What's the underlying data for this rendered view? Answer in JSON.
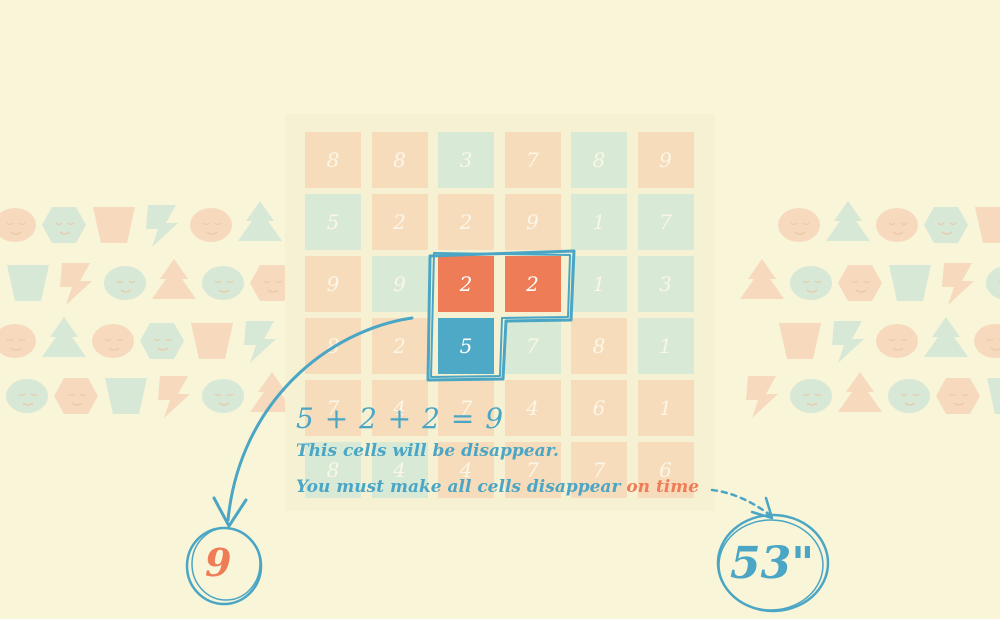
{
  "colors": {
    "background": "#f8f5d8",
    "peach": "#f7dcbc",
    "mint": "#d8e9d6",
    "accent_orange": "#ee7d57",
    "accent_blue": "#4ea9c6"
  },
  "grid": {
    "rows": [
      [
        {
          "v": "8",
          "c": "peach"
        },
        {
          "v": "8",
          "c": "peach"
        },
        {
          "v": "3",
          "c": "mint"
        },
        {
          "v": "7",
          "c": "peach"
        },
        {
          "v": "8",
          "c": "mint"
        },
        {
          "v": "9",
          "c": "peach"
        }
      ],
      [
        {
          "v": "5",
          "c": "mint"
        },
        {
          "v": "2",
          "c": "peach"
        },
        {
          "v": "2",
          "c": "peach"
        },
        {
          "v": "9",
          "c": "peach"
        },
        {
          "v": "1",
          "c": "mint"
        },
        {
          "v": "7",
          "c": "mint"
        }
      ],
      [
        {
          "v": "9",
          "c": "peach"
        },
        {
          "v": "9",
          "c": "mint"
        },
        {
          "v": "2",
          "c": "orange"
        },
        {
          "v": "2",
          "c": "orange"
        },
        {
          "v": "1",
          "c": "mint"
        },
        {
          "v": "3",
          "c": "mint"
        }
      ],
      [
        {
          "v": "8",
          "c": "peach"
        },
        {
          "v": "2",
          "c": "peach"
        },
        {
          "v": "5",
          "c": "blue"
        },
        {
          "v": "7",
          "c": "mint"
        },
        {
          "v": "8",
          "c": "peach"
        },
        {
          "v": "1",
          "c": "mint"
        }
      ],
      [
        {
          "v": "7",
          "c": "peach"
        },
        {
          "v": "4",
          "c": "peach"
        },
        {
          "v": "7",
          "c": "peach"
        },
        {
          "v": "4",
          "c": "peach"
        },
        {
          "v": "6",
          "c": "peach"
        },
        {
          "v": "1",
          "c": "peach"
        }
      ],
      [
        {
          "v": "8",
          "c": "mint"
        },
        {
          "v": "4",
          "c": "mint"
        },
        {
          "v": "4",
          "c": "peach"
        },
        {
          "v": "7",
          "c": "peach"
        },
        {
          "v": "7",
          "c": "peach"
        },
        {
          "v": "6",
          "c": "peach"
        }
      ]
    ]
  },
  "tutorial": {
    "equation": "5 + 2 + 2 = 9",
    "line1": "This cells will be disappear.",
    "line2_main": "You must make all cells disappear ",
    "line2_highlight": "on time"
  },
  "hud": {
    "score": "9",
    "timer": "53\""
  }
}
